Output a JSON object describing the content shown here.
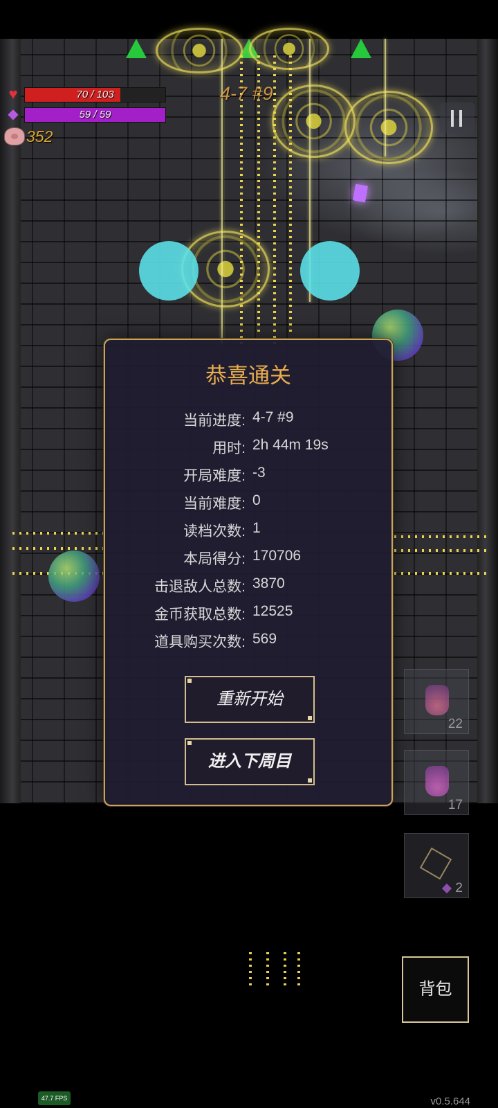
{
  "hud": {
    "hp": {
      "text": "70 / 103",
      "current": 70,
      "max": 103,
      "color": "#d01f1f"
    },
    "mana": {
      "text": "59 / 59",
      "current": 59,
      "max": 59,
      "color": "#a31fc7"
    },
    "coins": "352",
    "level": "4-7 #9",
    "icons": {
      "hp": "heart-icon",
      "mana": "gem-icon",
      "coins": "pig-icon",
      "pause": "pause-icon"
    }
  },
  "dialog": {
    "title": "恭喜通关",
    "stats": [
      {
        "label": "当前进度:",
        "value": "4-7 #9"
      },
      {
        "label": "用时:",
        "value": "2h 44m 19s"
      },
      {
        "label": "开局难度:",
        "value": "-3"
      },
      {
        "label": "当前难度:",
        "value": "0"
      },
      {
        "label": "读档次数:",
        "value": "1"
      },
      {
        "label": "本局得分:",
        "value": "170706"
      },
      {
        "label": "击退敌人总数:",
        "value": "3870"
      },
      {
        "label": "金币获取总数:",
        "value": "12525"
      },
      {
        "label": "道具购买次数:",
        "value": "569"
      }
    ],
    "restart_label": "重新开始",
    "next_label": "进入下周目"
  },
  "inventory": {
    "slots": [
      {
        "item": "potion-icon",
        "count": "22"
      },
      {
        "item": "potion-icon",
        "count": "17"
      },
      {
        "item": "crystal-icon",
        "count": "2"
      }
    ],
    "backpack_label": "背包"
  },
  "footer": {
    "fps": "47.7 FPS",
    "version": "v0.5.644"
  },
  "colors": {
    "accent": "#e9ad4e",
    "dialog_bg": "#201c32",
    "border": "#c9a45a"
  }
}
